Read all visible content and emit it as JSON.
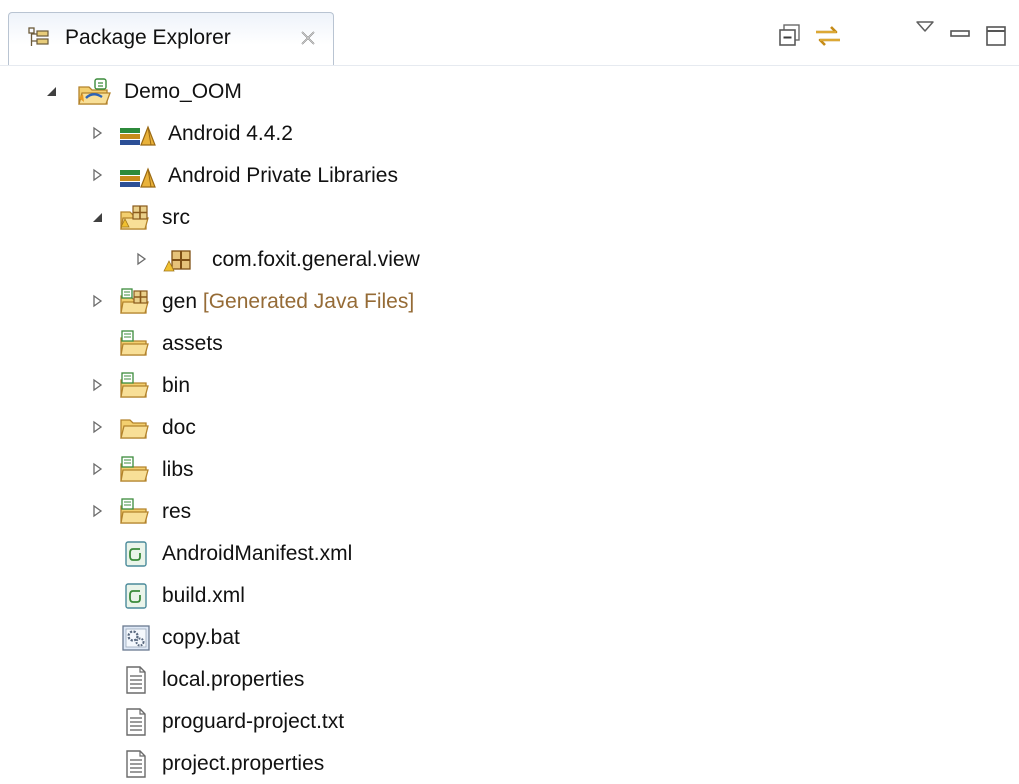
{
  "view": {
    "title": "Package Explorer",
    "close_symbol": "✕",
    "toolbar": {
      "collapse_all": "Collapse All",
      "link_with_editor": "Link with Editor",
      "view_menu": "View Menu",
      "minimize": "Minimize",
      "maximize": "Maximize"
    }
  },
  "tree": {
    "items": [
      {
        "label": "Demo_OOM",
        "state": "expanded",
        "icon": "android-project-folder-icon"
      },
      {
        "label": "Android 4.4.2",
        "state": "collapsed",
        "icon": "library-icon"
      },
      {
        "label": "Android Private Libraries",
        "state": "collapsed",
        "icon": "library-icon"
      },
      {
        "label": "src",
        "state": "expanded",
        "icon": "source-folder-icon"
      },
      {
        "label": "com.foxit.general.view",
        "state": "collapsed",
        "icon": "package-icon"
      },
      {
        "label": "gen",
        "decoration": "[Generated Java Files]",
        "state": "collapsed",
        "icon": "source-folder-icon"
      },
      {
        "label": "assets",
        "state": "leaf",
        "icon": "resource-folder-icon"
      },
      {
        "label": "bin",
        "state": "collapsed",
        "icon": "resource-folder-icon"
      },
      {
        "label": "doc",
        "state": "collapsed",
        "icon": "folder-icon"
      },
      {
        "label": "libs",
        "state": "collapsed",
        "icon": "resource-folder-icon"
      },
      {
        "label": "res",
        "state": "collapsed",
        "icon": "resource-folder-icon"
      },
      {
        "label": "AndroidManifest.xml",
        "state": "leaf",
        "icon": "xml-file-icon"
      },
      {
        "label": "build.xml",
        "state": "leaf",
        "icon": "xml-file-icon"
      },
      {
        "label": "copy.bat",
        "state": "leaf",
        "icon": "batch-file-icon"
      },
      {
        "label": "local.properties",
        "state": "leaf",
        "icon": "text-file-icon"
      },
      {
        "label": "proguard-project.txt",
        "state": "leaf",
        "icon": "text-file-icon"
      },
      {
        "label": "project.properties",
        "state": "leaf",
        "icon": "text-file-icon"
      }
    ]
  },
  "colors": {
    "decoration_text": "#956b36",
    "tab_border": "#b9c4d2",
    "folder_fill": "#f6d486",
    "folder_stroke": "#c99a3a",
    "library_green": "#2a8a3a",
    "library_blue": "#2c4f96"
  }
}
